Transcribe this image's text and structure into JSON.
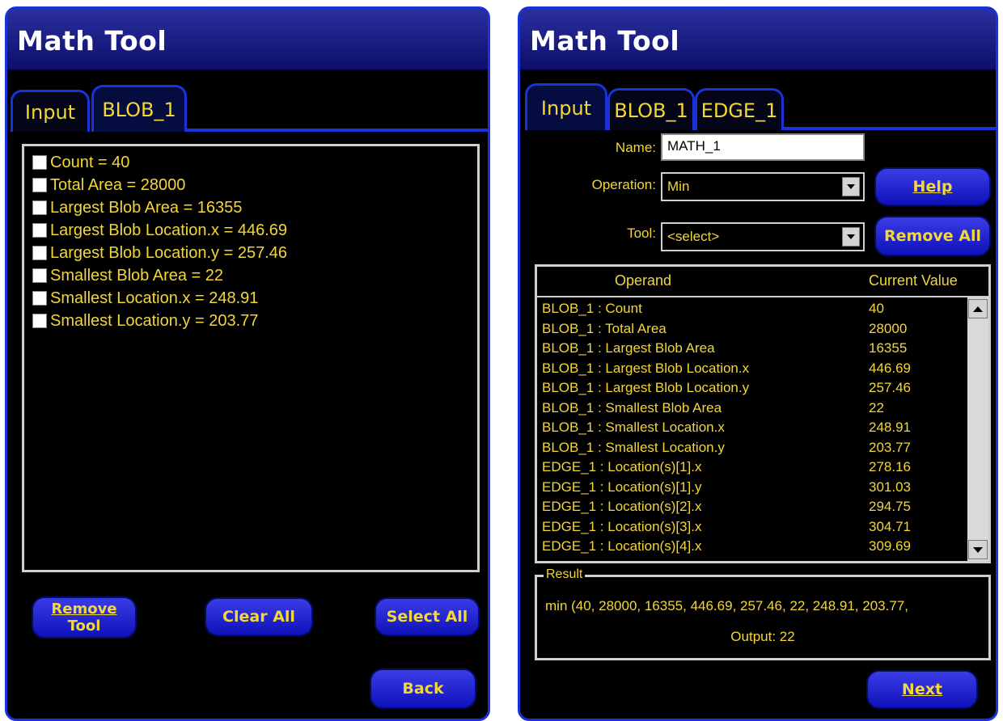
{
  "left": {
    "title": "Math Tool",
    "tabs": [
      {
        "label": "Input"
      },
      {
        "label": "BLOB_1"
      }
    ],
    "checkbox_items": [
      "Count = 40",
      "Total Area = 28000",
      "Largest Blob Area = 16355",
      "Largest Blob Location.x = 446.69",
      "Largest Blob Location.y = 257.46",
      "Smallest Blob Area = 22",
      "Smallest Location.x = 248.91",
      "Smallest Location.y = 203.77"
    ],
    "buttons": {
      "remove_tool_line1": "Remove",
      "remove_tool_line2": "Tool",
      "clear_all": "Clear All",
      "select_all": "Select All",
      "back": "Back"
    }
  },
  "right": {
    "title": "Math Tool",
    "tabs": [
      {
        "label": "Input"
      },
      {
        "label": "BLOB_1"
      },
      {
        "label": "EDGE_1"
      }
    ],
    "name_label": "Name:",
    "name_value": "MATH_1",
    "operation_label": "Operation:",
    "operation_value": "Min",
    "tool_label": "Tool:",
    "tool_value": "<select>",
    "help_button": "Help",
    "remove_all_button": "Remove All",
    "grid_headers": {
      "operand": "Operand",
      "current_value": "Current Value"
    },
    "grid_rows": [
      {
        "operand": "BLOB_1 : Count",
        "value": "40"
      },
      {
        "operand": "BLOB_1 : Total Area",
        "value": "28000"
      },
      {
        "operand": "BLOB_1 : Largest Blob Area",
        "value": "16355"
      },
      {
        "operand": "BLOB_1 : Largest Blob Location.x",
        "value": "446.69"
      },
      {
        "operand": "BLOB_1 : Largest Blob Location.y",
        "value": "257.46"
      },
      {
        "operand": "BLOB_1 : Smallest Blob Area",
        "value": "22"
      },
      {
        "operand": "BLOB_1 : Smallest Location.x",
        "value": "248.91"
      },
      {
        "operand": "BLOB_1 : Smallest Location.y",
        "value": "203.77"
      },
      {
        "operand": "EDGE_1 : Location(s)[1].x",
        "value": "278.16"
      },
      {
        "operand": "EDGE_1 : Location(s)[1].y",
        "value": "301.03"
      },
      {
        "operand": "EDGE_1 : Location(s)[2].x",
        "value": "294.75"
      },
      {
        "operand": "EDGE_1 : Location(s)[3].x",
        "value": "304.71"
      },
      {
        "operand": "EDGE_1 : Location(s)[4].x",
        "value": "309.69"
      }
    ],
    "result_label": "Result",
    "result_expression": "min  (40, 28000, 16355, 446.69, 257.46, 22, 248.91, 203.77,",
    "result_output": "Output: 22",
    "next_button": "Next"
  },
  "colors": {
    "accent_blue": "#1a33d9",
    "text_yellow": "#f2d63a",
    "background": "#000000"
  }
}
